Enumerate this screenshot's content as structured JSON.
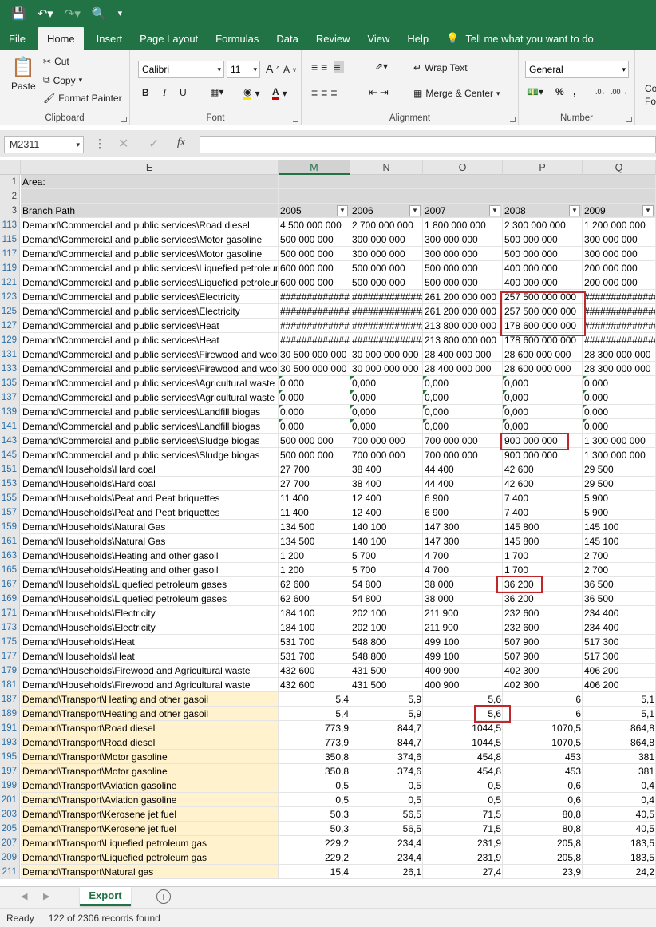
{
  "qat": {
    "save_icon": "save-icon",
    "undo_icon": "undo-icon",
    "redo_icon": "redo-icon",
    "preview_icon": "print-preview-icon",
    "more_icon": "customize-icon"
  },
  "tabs": [
    "File",
    "Home",
    "Insert",
    "Page Layout",
    "Formulas",
    "Data",
    "Review",
    "View",
    "Help"
  ],
  "tell_me": "Tell me what you want to do",
  "clipboard": {
    "paste": "Paste",
    "cut": "Cut",
    "copy": "Copy",
    "format_painter": "Format Painter",
    "label": "Clipboard"
  },
  "font": {
    "name": "Calibri",
    "size": "11",
    "bold": "B",
    "italic": "I",
    "underline": "U",
    "label": "Font"
  },
  "alignment": {
    "wrap": "Wrap Text",
    "merge": "Merge & Center",
    "label": "Alignment"
  },
  "number": {
    "format": "General",
    "label": "Number",
    "percent": "%",
    "comma": ","
  },
  "styles_partial": [
    "Co",
    "For"
  ],
  "formula_bar": {
    "name_box": "M2311",
    "fx": "fx",
    "value": ""
  },
  "columns": [
    "E",
    "M",
    "N",
    "O",
    "P",
    "Q"
  ],
  "header_rows": {
    "r1": {
      "num": "1",
      "label": "Area:"
    },
    "r2": {
      "num": "2",
      "label": ""
    },
    "r3": {
      "num": "3",
      "label": "Branch Path",
      "years": [
        "2005",
        "2006",
        "2007",
        "2008",
        "2009"
      ]
    }
  },
  "rows": [
    {
      "num": "113",
      "path": "Demand\\Commercial and public services\\Road diesel",
      "v": [
        "4 500 000 000",
        "2 700 000 000",
        "1 800 000 000",
        "2 300 000 000",
        "1 200 000 000"
      ]
    },
    {
      "num": "115",
      "path": "Demand\\Commercial and public services\\Motor gasoline",
      "v": [
        "500 000 000",
        "300 000 000",
        "300 000 000",
        "500 000 000",
        "300 000 000"
      ]
    },
    {
      "num": "117",
      "path": "Demand\\Commercial and public services\\Motor gasoline",
      "v": [
        "500 000 000",
        "300 000 000",
        "300 000 000",
        "500 000 000",
        "300 000 000"
      ]
    },
    {
      "num": "119",
      "path": "Demand\\Commercial and public services\\Liquefied petroleum gas",
      "v": [
        "600 000 000",
        "500 000 000",
        "500 000 000",
        "400 000 000",
        "200 000 000"
      ]
    },
    {
      "num": "121",
      "path": "Demand\\Commercial and public services\\Liquefied petroleum gas",
      "v": [
        "600 000 000",
        "500 000 000",
        "500 000 000",
        "400 000 000",
        "200 000 000"
      ]
    },
    {
      "num": "123",
      "path": "Demand\\Commercial and public services\\Electricity",
      "v": [
        "##############",
        "##############",
        "261 200 000 000",
        "257 500 000 000",
        "##############"
      ]
    },
    {
      "num": "125",
      "path": "Demand\\Commercial and public services\\Electricity",
      "v": [
        "##############",
        "##############",
        "261 200 000 000",
        "257 500 000 000",
        "##############"
      ]
    },
    {
      "num": "127",
      "path": "Demand\\Commercial and public services\\Heat",
      "v": [
        "##############",
        "##############",
        "213 800 000 000",
        "178 600 000 000",
        "##############"
      ]
    },
    {
      "num": "129",
      "path": "Demand\\Commercial and public services\\Heat",
      "v": [
        "##############",
        "##############",
        "213 800 000 000",
        "178 600 000 000",
        "##############"
      ]
    },
    {
      "num": "131",
      "path": "Demand\\Commercial and public services\\Firewood and wood",
      "v": [
        "30 500 000 000",
        "30 000 000 000",
        "28 400 000 000",
        "28 600 000 000",
        "28 300 000 000"
      ]
    },
    {
      "num": "133",
      "path": "Demand\\Commercial and public services\\Firewood and wood",
      "v": [
        "30 500 000 000",
        "30 000 000 000",
        "28 400 000 000",
        "28 600 000 000",
        "28 300 000 000"
      ]
    },
    {
      "num": "135",
      "path": "Demand\\Commercial and public services\\Agricultural waste",
      "v": [
        "0,000",
        "0,000",
        "0,000",
        "0,000",
        "0,000"
      ],
      "tri": true
    },
    {
      "num": "137",
      "path": "Demand\\Commercial and public services\\Agricultural waste",
      "v": [
        "0,000",
        "0,000",
        "0,000",
        "0,000",
        "0,000"
      ],
      "tri": true
    },
    {
      "num": "139",
      "path": "Demand\\Commercial and public services\\Landfill biogas",
      "v": [
        "0,000",
        "0,000",
        "0,000",
        "0,000",
        "0,000"
      ],
      "tri": true
    },
    {
      "num": "141",
      "path": "Demand\\Commercial and public services\\Landfill biogas",
      "v": [
        "0,000",
        "0,000",
        "0,000",
        "0,000",
        "0,000"
      ],
      "tri": true
    },
    {
      "num": "143",
      "path": "Demand\\Commercial and public services\\Sludge biogas",
      "v": [
        "500 000 000",
        "700 000 000",
        "700 000 000",
        "900 000 000",
        "1 300 000 000"
      ]
    },
    {
      "num": "145",
      "path": "Demand\\Commercial and public services\\Sludge biogas",
      "v": [
        "500 000 000",
        "700 000 000",
        "700 000 000",
        "900 000 000",
        "1 300 000 000"
      ]
    },
    {
      "num": "151",
      "path": "Demand\\Households\\Hard coal",
      "v": [
        "27 700",
        "38 400",
        "44 400",
        "42 600",
        "29 500"
      ]
    },
    {
      "num": "153",
      "path": "Demand\\Households\\Hard coal",
      "v": [
        "27 700",
        "38 400",
        "44 400",
        "42 600",
        "29 500"
      ]
    },
    {
      "num": "155",
      "path": "Demand\\Households\\Peat and Peat briquettes",
      "v": [
        "11 400",
        "12 400",
        "6 900",
        "7 400",
        "5 900"
      ]
    },
    {
      "num": "157",
      "path": "Demand\\Households\\Peat and Peat briquettes",
      "v": [
        "11 400",
        "12 400",
        "6 900",
        "7 400",
        "5 900"
      ]
    },
    {
      "num": "159",
      "path": "Demand\\Households\\Natural Gas",
      "v": [
        "134 500",
        "140 100",
        "147 300",
        "145 800",
        "145 100"
      ]
    },
    {
      "num": "161",
      "path": "Demand\\Households\\Natural Gas",
      "v": [
        "134 500",
        "140 100",
        "147 300",
        "145 800",
        "145 100"
      ]
    },
    {
      "num": "163",
      "path": "Demand\\Households\\Heating and other gasoil",
      "v": [
        "1 200",
        "5 700",
        "4 700",
        "1 700",
        "2 700"
      ]
    },
    {
      "num": "165",
      "path": "Demand\\Households\\Heating and other gasoil",
      "v": [
        "1 200",
        "5 700",
        "4 700",
        "1 700",
        "2 700"
      ]
    },
    {
      "num": "167",
      "path": "Demand\\Households\\Liquefied petroleum gases",
      "v": [
        "62 600",
        "54 800",
        "38 000",
        "36 200",
        "36 500"
      ]
    },
    {
      "num": "169",
      "path": "Demand\\Households\\Liquefied petroleum gases",
      "v": [
        "62 600",
        "54 800",
        "38 000",
        "36 200",
        "36 500"
      ]
    },
    {
      "num": "171",
      "path": "Demand\\Households\\Electricity",
      "v": [
        "184 100",
        "202 100",
        "211 900",
        "232 600",
        "234 400"
      ]
    },
    {
      "num": "173",
      "path": "Demand\\Households\\Electricity",
      "v": [
        "184 100",
        "202 100",
        "211 900",
        "232 600",
        "234 400"
      ]
    },
    {
      "num": "175",
      "path": "Demand\\Households\\Heat",
      "v": [
        "531 700",
        "548 800",
        "499 100",
        "507 900",
        "517 300"
      ]
    },
    {
      "num": "177",
      "path": "Demand\\Households\\Heat",
      "v": [
        "531 700",
        "548 800",
        "499 100",
        "507 900",
        "517 300"
      ]
    },
    {
      "num": "179",
      "path": "Demand\\Households\\Firewood and Agricultural waste",
      "v": [
        "432 600",
        "431 500",
        "400 900",
        "402 300",
        "406 200"
      ]
    },
    {
      "num": "181",
      "path": "Demand\\Households\\Firewood and Agricultural waste",
      "v": [
        "432 600",
        "431 500",
        "400 900",
        "402 300",
        "406 200"
      ]
    },
    {
      "num": "187",
      "path": "Demand\\Transport\\Heating and other gasoil",
      "v": [
        "5,4",
        "5,9",
        "5,6",
        "6",
        "5,1"
      ],
      "right": true
    },
    {
      "num": "189",
      "path": "Demand\\Transport\\Heating and other gasoil",
      "v": [
        "5,4",
        "5,9",
        "5,6",
        "6",
        "5,1"
      ],
      "right": true
    },
    {
      "num": "191",
      "path": "Demand\\Transport\\Road diesel",
      "v": [
        "773,9",
        "844,7",
        "1044,5",
        "1070,5",
        "864,8"
      ],
      "right": true
    },
    {
      "num": "193",
      "path": "Demand\\Transport\\Road diesel",
      "v": [
        "773,9",
        "844,7",
        "1044,5",
        "1070,5",
        "864,8"
      ],
      "right": true
    },
    {
      "num": "195",
      "path": "Demand\\Transport\\Motor gasoline",
      "v": [
        "350,8",
        "374,6",
        "454,8",
        "453",
        "381"
      ],
      "right": true
    },
    {
      "num": "197",
      "path": "Demand\\Transport\\Motor gasoline",
      "v": [
        "350,8",
        "374,6",
        "454,8",
        "453",
        "381"
      ],
      "right": true
    },
    {
      "num": "199",
      "path": "Demand\\Transport\\Aviation gasoline",
      "v": [
        "0,5",
        "0,5",
        "0,5",
        "0,6",
        "0,4"
      ],
      "right": true
    },
    {
      "num": "201",
      "path": "Demand\\Transport\\Aviation gasoline",
      "v": [
        "0,5",
        "0,5",
        "0,5",
        "0,6",
        "0,4"
      ],
      "right": true
    },
    {
      "num": "203",
      "path": "Demand\\Transport\\Kerosene jet fuel",
      "v": [
        "50,3",
        "56,5",
        "71,5",
        "80,8",
        "40,5"
      ],
      "right": true
    },
    {
      "num": "205",
      "path": "Demand\\Transport\\Kerosene jet fuel",
      "v": [
        "50,3",
        "56,5",
        "71,5",
        "80,8",
        "40,5"
      ],
      "right": true
    },
    {
      "num": "207",
      "path": "Demand\\Transport\\Liquefied petroleum gas",
      "v": [
        "229,2",
        "234,4",
        "231,9",
        "205,8",
        "183,5"
      ],
      "right": true
    },
    {
      "num": "209",
      "path": "Demand\\Transport\\Liquefied petroleum gas",
      "v": [
        "229,2",
        "234,4",
        "231,9",
        "205,8",
        "183,5"
      ],
      "right": true
    },
    {
      "num": "211",
      "path": "Demand\\Transport\\Natural gas",
      "v": [
        "15,4",
        "26,1",
        "27,4",
        "23,9",
        "24,2"
      ],
      "right": true
    }
  ],
  "sheet": {
    "name": "Export",
    "add_icon": "add-sheet-icon"
  },
  "status": {
    "ready": "Ready",
    "records": "122 of 2306 records found"
  },
  "colors": {
    "excel_green": "#217346",
    "highlight_red": "#c0272d",
    "transport_fill": "#fff2cc"
  }
}
